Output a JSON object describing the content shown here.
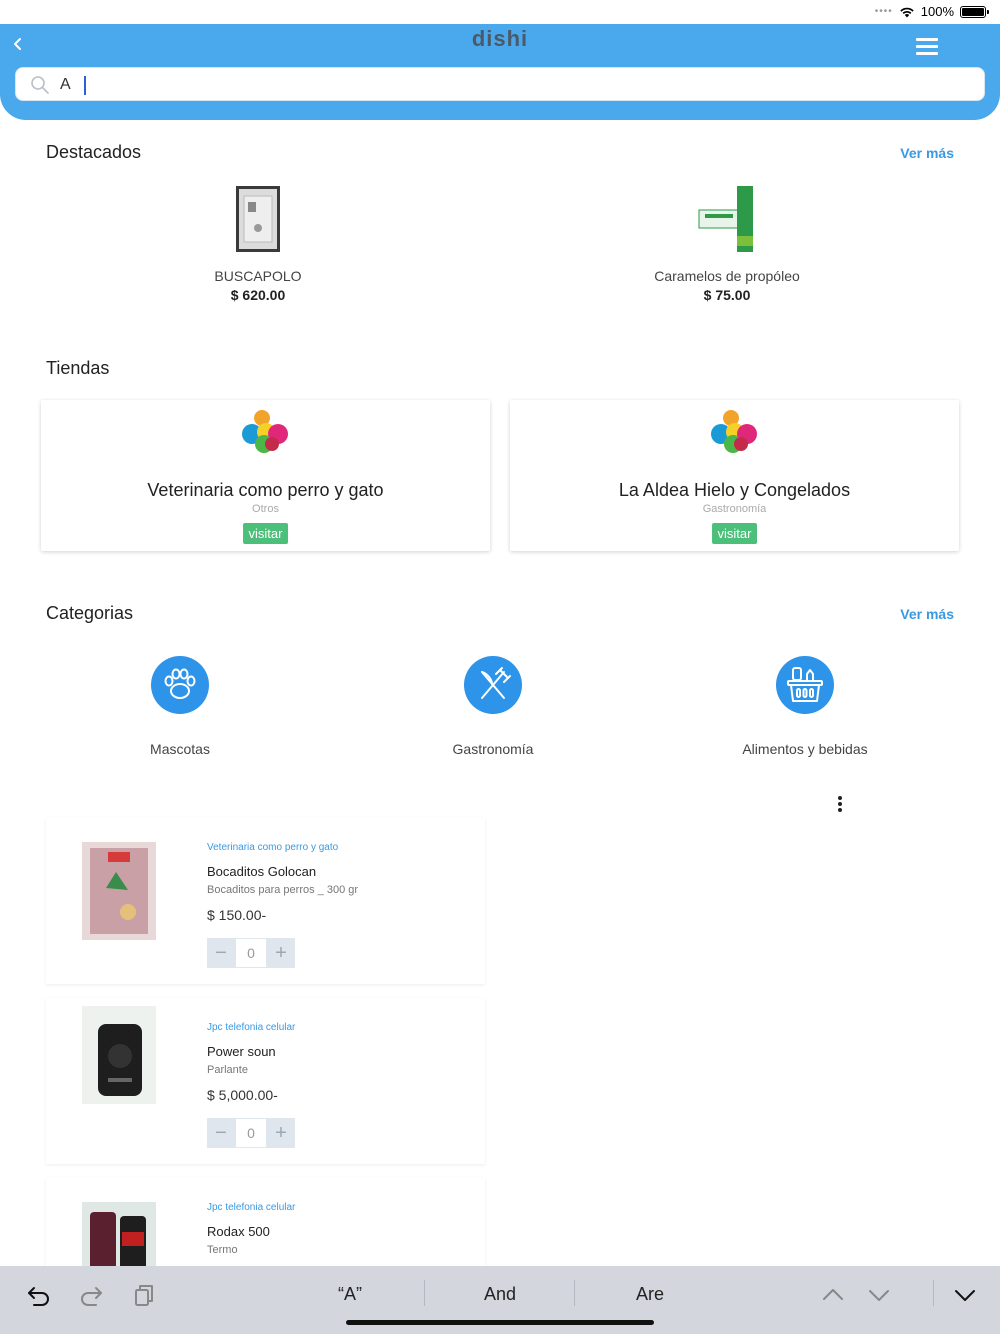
{
  "status_bar": {
    "battery": "100%"
  },
  "header": {
    "logo": "dishi",
    "search_value": "A",
    "back_icon": "chevron-left-icon",
    "menu_icon": "hamburger-icon"
  },
  "featured": {
    "title": "Destacados",
    "more": "Ver más",
    "items": [
      {
        "name": "BUSCAPOLO",
        "price": "$ 620.00"
      },
      {
        "name": "Caramelos de propóleo",
        "price": "$ 75.00"
      }
    ]
  },
  "stores": {
    "title": "Tiendas",
    "items": [
      {
        "name": "Veterinaria como perro y gato",
        "category": "Otros",
        "action": "visitar"
      },
      {
        "name": "La Aldea Hielo y Congelados",
        "category": "Gastronomía",
        "action": "visitar"
      }
    ]
  },
  "categories": {
    "title": "Categorias",
    "more": "Ver más",
    "items": [
      {
        "label": "Mascotas",
        "icon": "paw-icon"
      },
      {
        "label": "Gastronomía",
        "icon": "utensils-icon"
      },
      {
        "label": "Alimentos y bebidas",
        "icon": "basket-icon"
      }
    ]
  },
  "products": [
    {
      "store": "Veterinaria como perro y gato",
      "name": "Bocaditos Golocan",
      "desc": "Bocaditos para perros _ 300 gr",
      "price": "$ 150.00-",
      "qty": "0"
    },
    {
      "store": "Jpc telefonia celular",
      "name": "Power soun",
      "desc": "Parlante",
      "price": "$ 5,000.00-",
      "qty": "0"
    },
    {
      "store": "Jpc telefonia celular",
      "name": "Rodax 500",
      "desc": "Termo",
      "price": "",
      "qty": ""
    }
  ],
  "keyboard": {
    "suggestions": [
      "“A”",
      "And",
      "Are"
    ]
  },
  "colors": {
    "accent": "#4aa8ec",
    "link": "#3a9ae0",
    "visit": "#4cc07a",
    "category": "#2d94ea"
  }
}
